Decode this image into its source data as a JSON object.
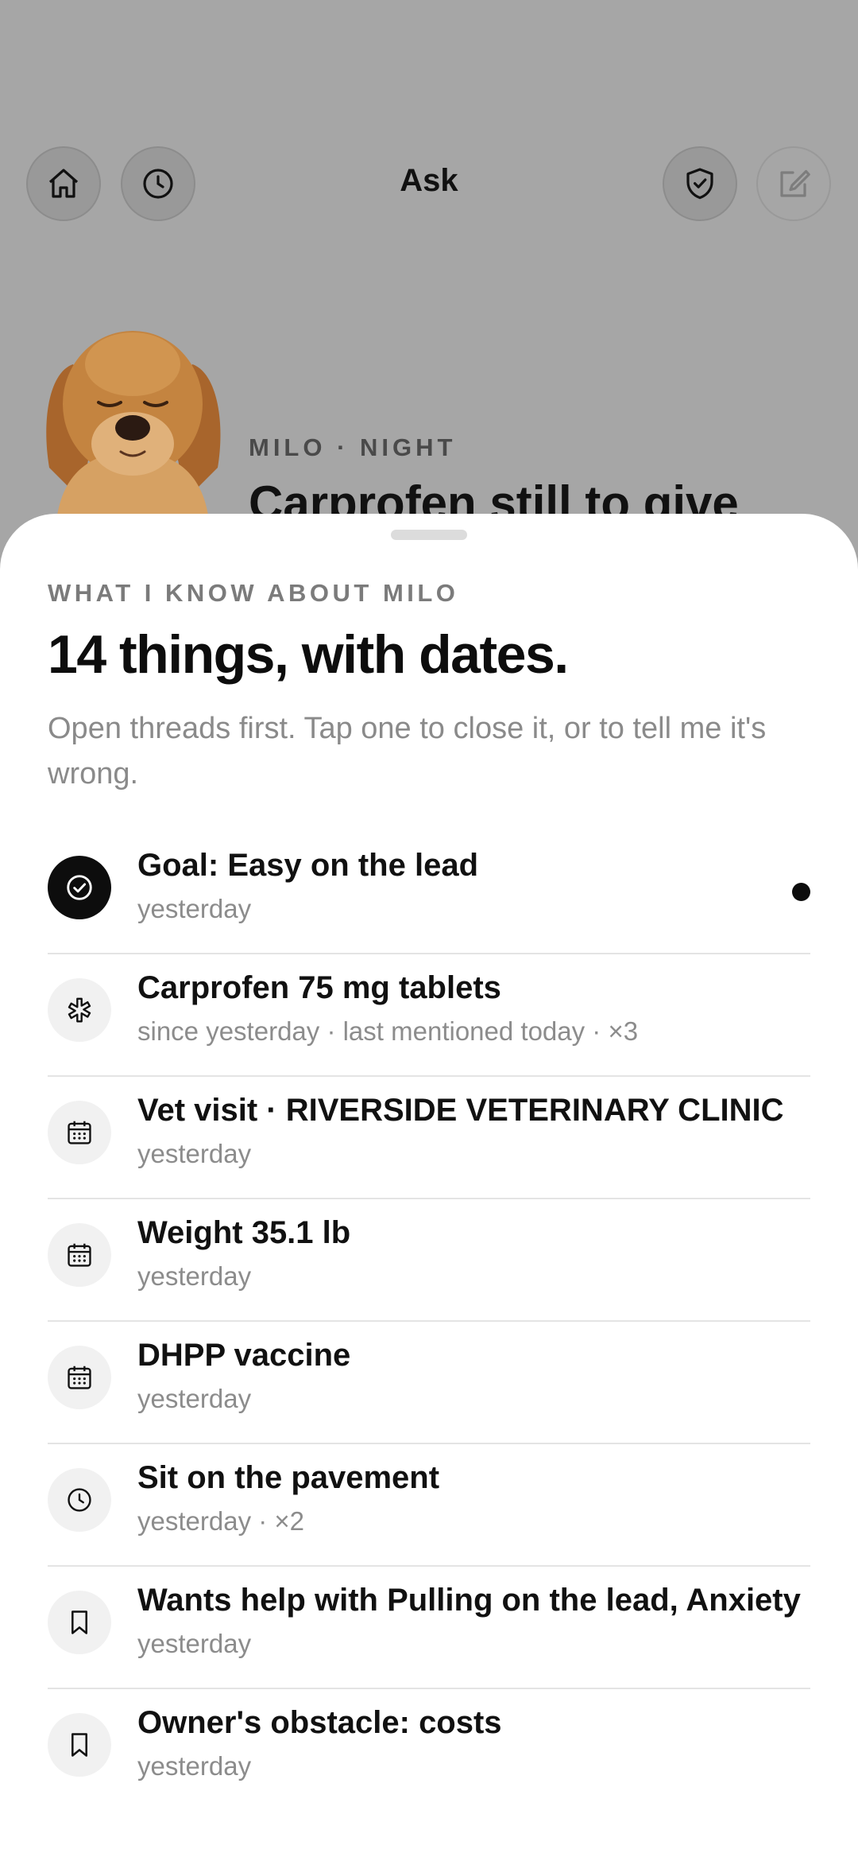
{
  "header": {
    "title": "Ask",
    "buttons": {
      "home": "home-icon",
      "history": "clock-icon",
      "shield": "shield-check-icon",
      "compose": "compose-icon"
    }
  },
  "context": {
    "label": "MILO · NIGHT",
    "title": "Carprofen still to give"
  },
  "sheet": {
    "eyebrow": "WHAT I KNOW ABOUT MILO",
    "title": "14 things, with dates.",
    "subtitle": "Open threads first. Tap one to close it, or to tell me it's wrong.",
    "items": [
      {
        "title": "Goal: Easy on the lead",
        "meta": "yesterday",
        "icon": "check-circle-icon",
        "unread": true
      },
      {
        "title": "Carprofen 75 mg tablets",
        "meta": "since yesterday · last mentioned today · ×3",
        "icon": "medication-icon"
      },
      {
        "title": "Vet visit · RIVERSIDE VETERINARY CLINIC",
        "meta": "yesterday",
        "icon": "calendar-icon"
      },
      {
        "title": "Weight 35.1 lb",
        "meta": "yesterday",
        "icon": "calendar-icon"
      },
      {
        "title": "DHPP vaccine",
        "meta": "yesterday",
        "icon": "calendar-icon"
      },
      {
        "title": "Sit on the pavement",
        "meta": "yesterday · ×2",
        "icon": "clock-icon"
      },
      {
        "title": "Wants help with Pulling on the lead, Anxiety",
        "meta": "yesterday",
        "icon": "bookmark-icon"
      },
      {
        "title": "Owner's obstacle: costs",
        "meta": "yesterday",
        "icon": "bookmark-icon"
      }
    ]
  },
  "colors": {
    "scrim": "#a6a6a6",
    "sheet": "#ffffff",
    "text": "#111111",
    "muted": "#8a8a8a",
    "accent": "#0d0d0d"
  }
}
